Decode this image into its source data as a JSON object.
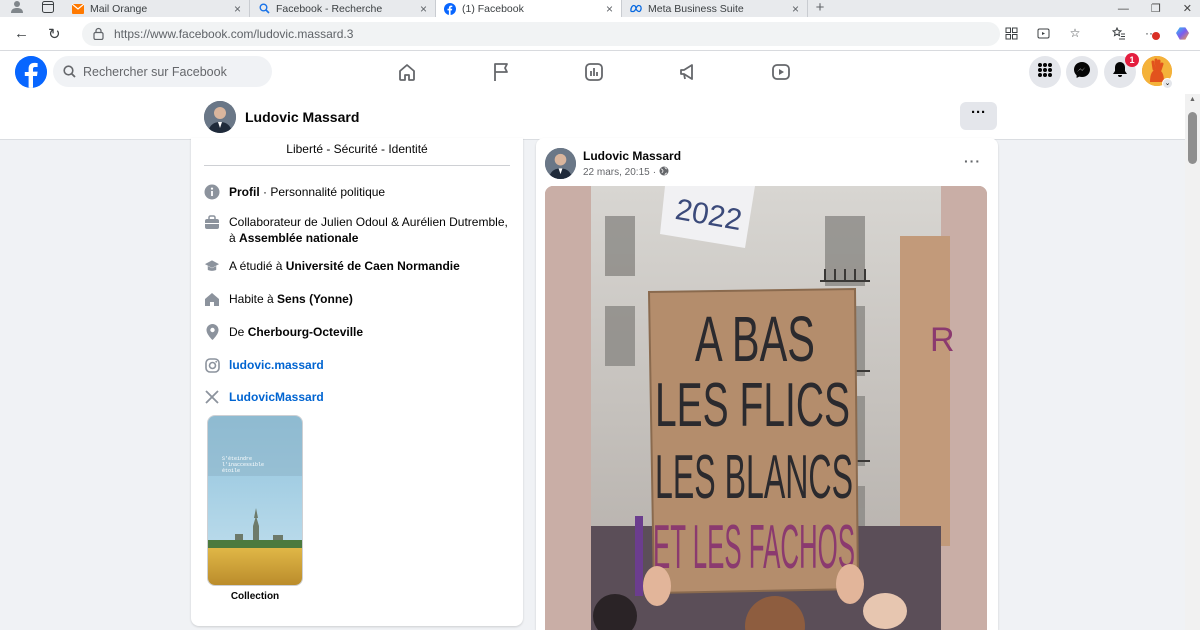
{
  "browser": {
    "tabs": [
      {
        "title": "Mail Orange",
        "icon": "mail-icon"
      },
      {
        "title": "Facebook - Recherche",
        "icon": "search-icon"
      },
      {
        "title": "(1) Facebook",
        "icon": "facebook-icon"
      },
      {
        "title": "Meta Business Suite",
        "icon": "meta-icon"
      }
    ],
    "url": "https://www.facebook.com/ludovic.massard.3"
  },
  "fb_header": {
    "search_placeholder": "Rechercher sur Facebook",
    "notification_count": "1"
  },
  "profile_bar": {
    "name": "Ludovic Massard",
    "more_label": "···"
  },
  "intro": {
    "motto": "Liberté - Sécurité - Identité",
    "profile_type_label": "Profil",
    "profile_type_value": "Personnalité politique",
    "work_prefix": "Collaborateur de Julien Odoul & Aurélien Dutremble, à",
    "work_place": "Assemblée nationale",
    "study_prefix": "A étudié à",
    "study_place": "Université de Caen Normandie",
    "lives_prefix": "Habite à",
    "lives_place": "Sens (Yonne)",
    "from_prefix": "De",
    "from_place": "Cherbourg-Octeville",
    "instagram": "ludovic.massard",
    "x_handle": "LudovicMassard",
    "collection_label": "Collection",
    "collection_overlay": [
      "S'éteindre",
      "l'inaccessible",
      "étoile"
    ]
  },
  "post": {
    "author": "Ludovic Massard",
    "date": "22 mars, 20:15",
    "more_label": "···",
    "sign_lines": [
      "A BAS",
      "LES FLICS",
      "LES BLANCS",
      "ET LES FACHOS"
    ],
    "banner_text": "2022"
  },
  "colors": {
    "facebook_blue": "#0866ff",
    "link_blue": "#0064d1",
    "notification_red": "#e41e3f",
    "sign_purple": "#8b3a6f",
    "sign_black": "#2b2a2e"
  }
}
